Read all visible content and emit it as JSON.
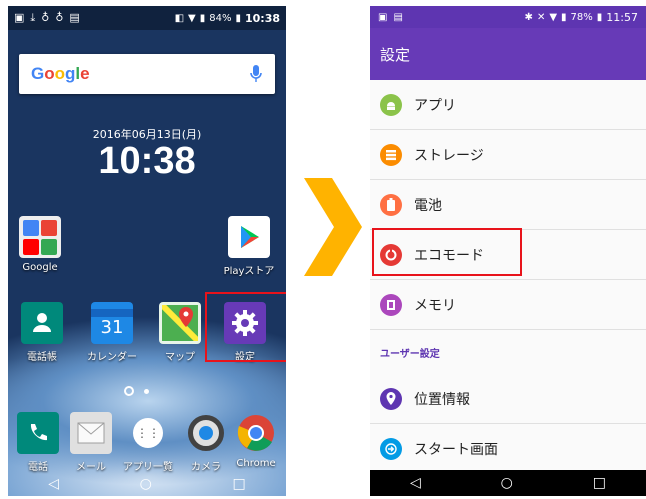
{
  "left_screen": {
    "status": {
      "battery": "84%",
      "time": "10:38"
    },
    "search": {
      "logo": "Google",
      "mic_icon": "mic-icon"
    },
    "date": "2016年06月13日(月)",
    "clock": "10:38",
    "apps": {
      "google": "Google",
      "play_store": "Playストア",
      "contacts": "電話帳",
      "calendar": "カレンダー",
      "calendar_day": "31",
      "maps": "マップ",
      "settings": "設定",
      "phone": "電話",
      "mail": "メール",
      "app_list": "アプリ一覧",
      "camera": "カメラ",
      "chrome": "Chrome"
    },
    "nav": {
      "back": "◁",
      "home": "○",
      "recent": "□"
    }
  },
  "right_screen": {
    "status": {
      "battery": "78%",
      "time": "11:57"
    },
    "title": "設定",
    "items": [
      {
        "label": "アプリ",
        "icon": "android-icon",
        "color": "#8bc34a"
      },
      {
        "label": "ストレージ",
        "icon": "storage-icon",
        "color": "#fb8c00"
      },
      {
        "label": "電池",
        "icon": "battery-icon",
        "color": "#ff7043"
      },
      {
        "label": "エコモード",
        "icon": "eco-mode-icon",
        "color": "#e53935"
      },
      {
        "label": "メモリ",
        "icon": "memory-icon",
        "color": "#ab47bc"
      }
    ],
    "section_header": "ユーザー設定",
    "user_items": [
      {
        "label": "位置情報",
        "icon": "location-icon",
        "color": "#5e35b1"
      },
      {
        "label": "スタート画面",
        "icon": "start-screen-icon",
        "color": "#039be5"
      }
    ],
    "nav": {
      "back": "◁",
      "home": "○",
      "recent": "□"
    }
  },
  "colors": {
    "accent_purple": "#673ab7",
    "highlight_red": "#e8131b",
    "arrow_orange": "#ffb300"
  }
}
